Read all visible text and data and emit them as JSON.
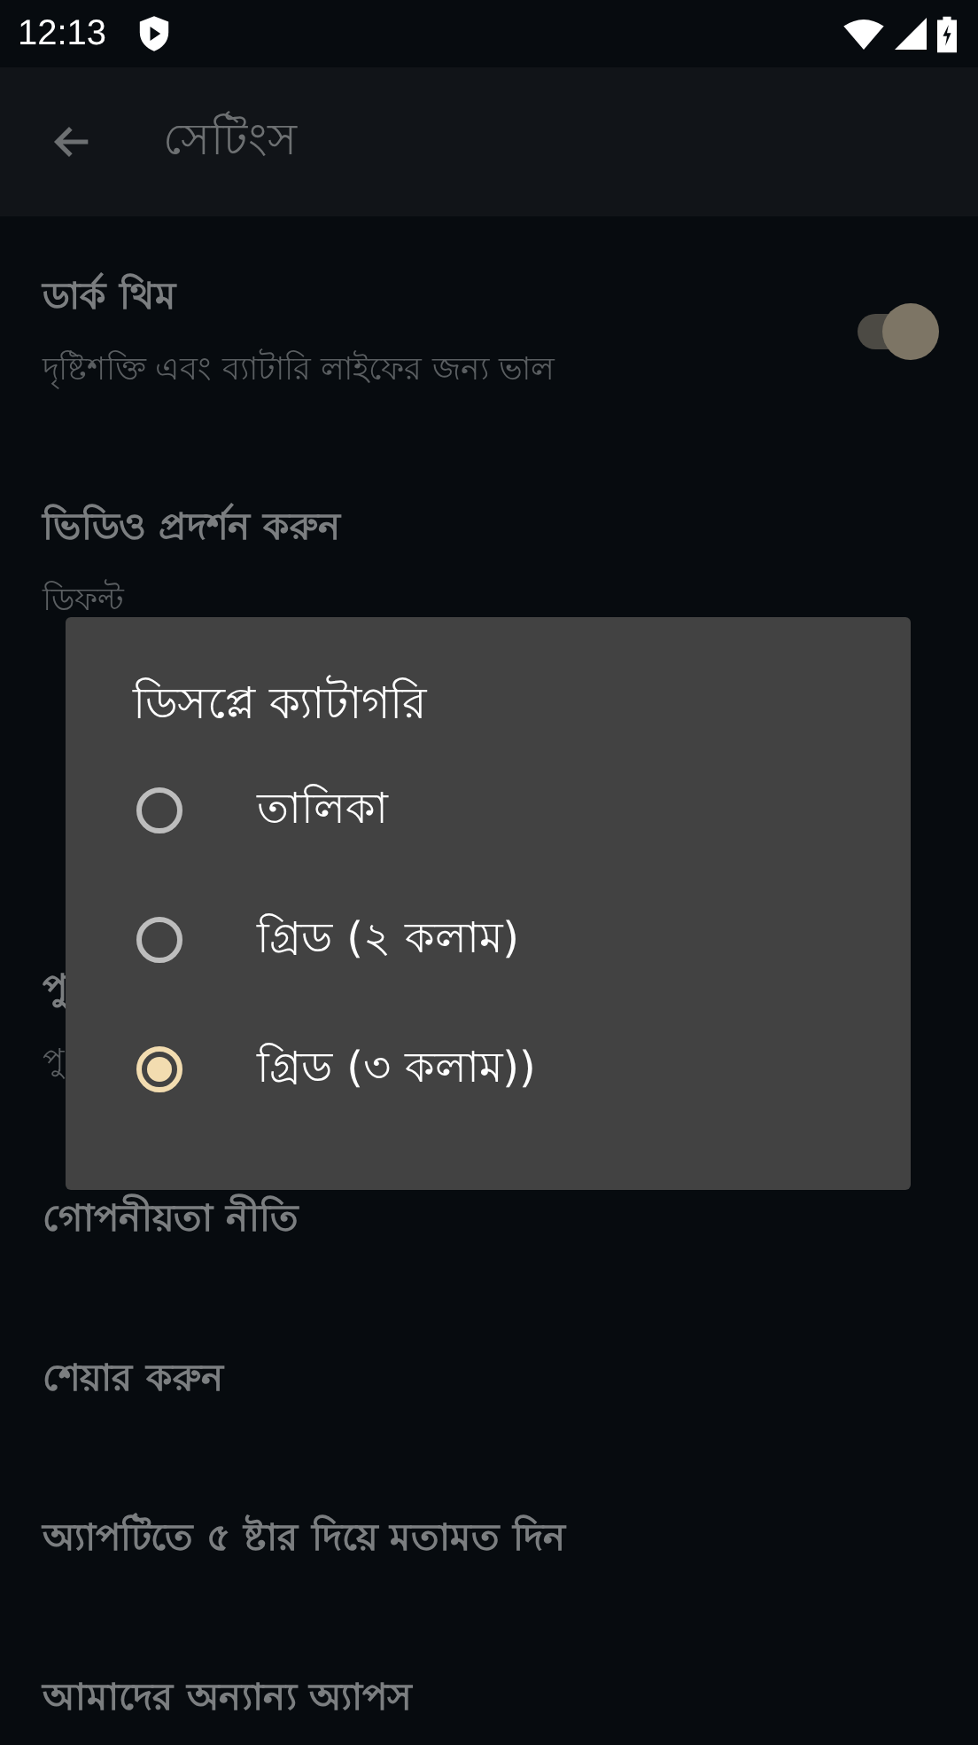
{
  "status_bar": {
    "time": "12:13"
  },
  "app_bar": {
    "title": "সেটিংস"
  },
  "settings": [
    {
      "kind": "switch",
      "title": "ডার্ক থিম",
      "subtitle": "দৃষ্টিশক্তি এবং ব্যাটারি লাইফের জন্য ভাল",
      "on": true
    },
    {
      "kind": "text",
      "title": "ভিডিও প্রদর্শন করুন",
      "subtitle": "ডিফল্ট"
    },
    {
      "kind": "covered"
    },
    {
      "kind": "text",
      "title": "পু",
      "subtitle": "পু"
    },
    {
      "kind": "text",
      "title": "গোপনীয়তা নীতি"
    },
    {
      "kind": "text",
      "title": "শেয়ার করুন"
    },
    {
      "kind": "text",
      "title": "অ্যাপটিতে ৫ ষ্টার দিয়ে মতামত দিন"
    },
    {
      "kind": "text",
      "title": "আমাদের অন্যান্য অ্যাপস"
    }
  ],
  "dialog": {
    "title": "ডিসপ্লে ক্যাটাগরি",
    "options": [
      {
        "label": "তালিকা",
        "selected": false
      },
      {
        "label": "গ্রিড (২ কলাম)",
        "selected": false
      },
      {
        "label": "গ্রিড (৩ কলাম))",
        "selected": true
      }
    ]
  }
}
